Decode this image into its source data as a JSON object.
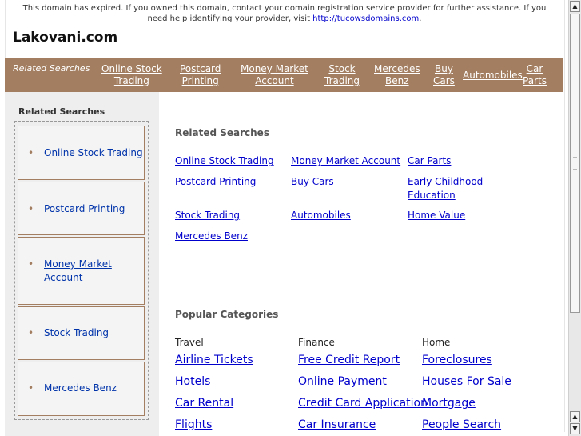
{
  "notice": {
    "text": "This domain has expired. If you owned this domain, contact your domain registration service provider for further assistance. If you need help identifying your provider, visit ",
    "link": "http://tucowsdomains.com",
    "end": "."
  },
  "site_title": "Lakovani.com",
  "nav": {
    "label": "Related Searches",
    "items": [
      {
        "line1": "Online Stock",
        "line2": "Trading"
      },
      {
        "line1": "Postcard",
        "line2": "Printing"
      },
      {
        "line1": "Money Market",
        "line2": "Account"
      },
      {
        "line1": "Stock",
        "line2": "Trading"
      },
      {
        "line1": "Mercedes",
        "line2": "Benz"
      },
      {
        "line1": "Buy",
        "line2": "Cars"
      },
      {
        "line1": "Automobiles",
        "line2": ""
      },
      {
        "line1": "Car",
        "line2": "Parts"
      }
    ]
  },
  "sidebar": {
    "title": "Related Searches",
    "bullet": "•",
    "items": [
      {
        "label": "Online Stock Trading"
      },
      {
        "label": "Postcard Printing"
      },
      {
        "label": "Money Market Account"
      },
      {
        "label": "Stock Trading"
      },
      {
        "label": "Mercedes Benz"
      }
    ]
  },
  "main": {
    "related_title": "Related Searches",
    "related_links": [
      "Online Stock Trading",
      "Money Market Account",
      "Car Parts",
      "Postcard Printing",
      "Buy Cars",
      "Early Childhood Education",
      "Stock Trading",
      "Automobiles",
      "Home Value",
      "Mercedes Benz"
    ],
    "popular_title": "Popular Categories",
    "categories": [
      {
        "heading": "Travel",
        "links": [
          "Airline Tickets",
          "Hotels",
          "Car Rental",
          "Flights"
        ]
      },
      {
        "heading": "Finance",
        "links": [
          "Free Credit Report",
          "Online Payment",
          "Credit Card Application",
          "Car Insurance"
        ]
      },
      {
        "heading": "Home",
        "links": [
          "Foreclosures",
          "Houses For Sale",
          "Mortgage",
          "People Search"
        ]
      }
    ]
  },
  "scrollbar": {
    "up_arrow": "▲",
    "down_arrow": "▼"
  }
}
